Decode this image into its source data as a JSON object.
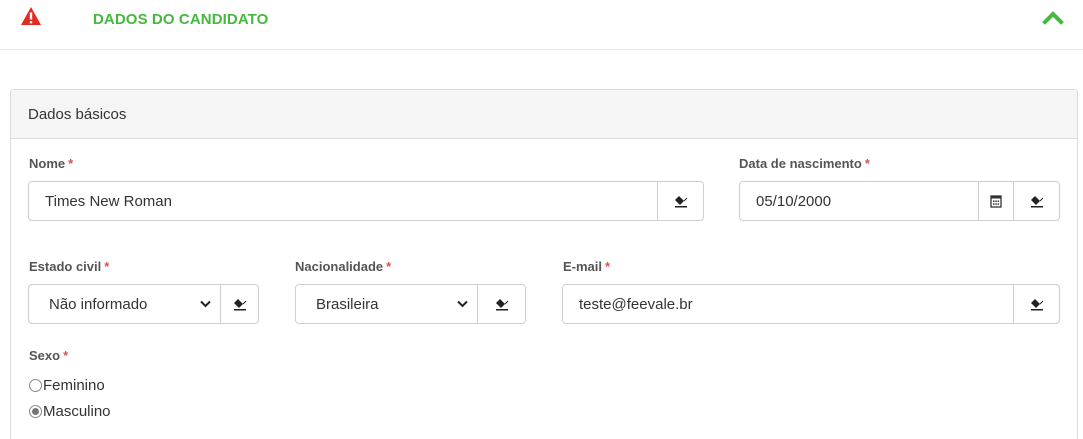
{
  "section": {
    "title": "DADOS DO CANDIDATO",
    "warning_icon": "warning-triangle-icon",
    "collapse_icon": "chevron-up-icon",
    "accent_color": "#46b83f",
    "warning_color": "#e32b22"
  },
  "panel": {
    "heading": "Dados básicos"
  },
  "required_mark": "*",
  "fields": {
    "nome": {
      "label": "Nome",
      "value": "Times New Roman",
      "icon": "eraser-icon"
    },
    "nascimento": {
      "label": "Data de nascimento",
      "value": "05/10/2000",
      "icons": [
        "calendar-icon",
        "eraser-icon"
      ]
    },
    "estado_civil": {
      "label": "Estado civil",
      "value": "Não informado",
      "icon": "eraser-icon"
    },
    "nacionalidade": {
      "label": "Nacionalidade",
      "value": "Brasileira",
      "icon": "eraser-icon"
    },
    "email": {
      "label": "E-mail",
      "value": "teste@feevale.br",
      "icon": "eraser-icon"
    }
  },
  "sexo": {
    "label": "Sexo",
    "options": [
      {
        "label": "Feminino",
        "checked": false
      },
      {
        "label": "Masculino",
        "checked": true
      }
    ]
  }
}
